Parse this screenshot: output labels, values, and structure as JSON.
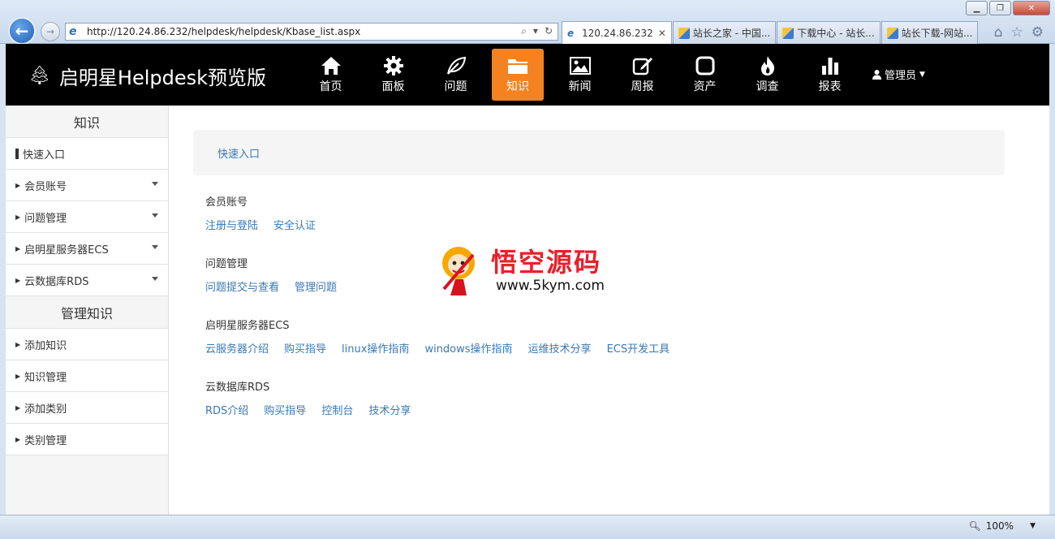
{
  "browser": {
    "url": "http://120.24.86.232/helpdesk/helpdesk/Kbase_list.aspx",
    "tabs": [
      {
        "label": "120.24.86.232",
        "active": true
      },
      {
        "label": "站长之家 - 中国...",
        "active": false
      },
      {
        "label": "下载中心 - 站长...",
        "active": false
      },
      {
        "label": "站长下载-网站...",
        "active": false
      }
    ],
    "zoom": "100%"
  },
  "app": {
    "brand": "启明星Helpdesk预览版",
    "nav": [
      {
        "label": "首页",
        "icon": "home-icon"
      },
      {
        "label": "面板",
        "icon": "gear-icon"
      },
      {
        "label": "问题",
        "icon": "leaf-icon"
      },
      {
        "label": "知识",
        "icon": "folder-icon",
        "active": true
      },
      {
        "label": "新闻",
        "icon": "image-icon"
      },
      {
        "label": "周报",
        "icon": "edit-icon"
      },
      {
        "label": "资产",
        "icon": "square-icon"
      },
      {
        "label": "调查",
        "icon": "fire-icon"
      },
      {
        "label": "报表",
        "icon": "bar-chart-icon"
      }
    ],
    "user": "管理员"
  },
  "sidebar": {
    "heading1": "知识",
    "items1": [
      "快速入口",
      "会员账号",
      "问题管理",
      "启明星服务器ECS",
      "云数据库RDS"
    ],
    "heading2": "管理知识",
    "items2": [
      "添加知识",
      "知识管理",
      "添加类别",
      "类别管理"
    ]
  },
  "content": {
    "quick": "快速入口",
    "sections": [
      {
        "title": "会员账号",
        "links": [
          "注册与登陆",
          "安全认证"
        ]
      },
      {
        "title": "问题管理",
        "links": [
          "问题提交与查看",
          "管理问题"
        ]
      },
      {
        "title": "启明星服务器ECS",
        "links": [
          "云服务器介绍",
          "购买指导",
          "linux操作指南",
          "windows操作指南",
          "运维技术分享",
          "ECS开发工具"
        ]
      },
      {
        "title": "云数据库RDS",
        "links": [
          "RDS介绍",
          "购买指导",
          "控制台",
          "技术分享"
        ]
      }
    ]
  },
  "watermark": {
    "title": "悟空源码",
    "url": "www.5kym.com"
  }
}
